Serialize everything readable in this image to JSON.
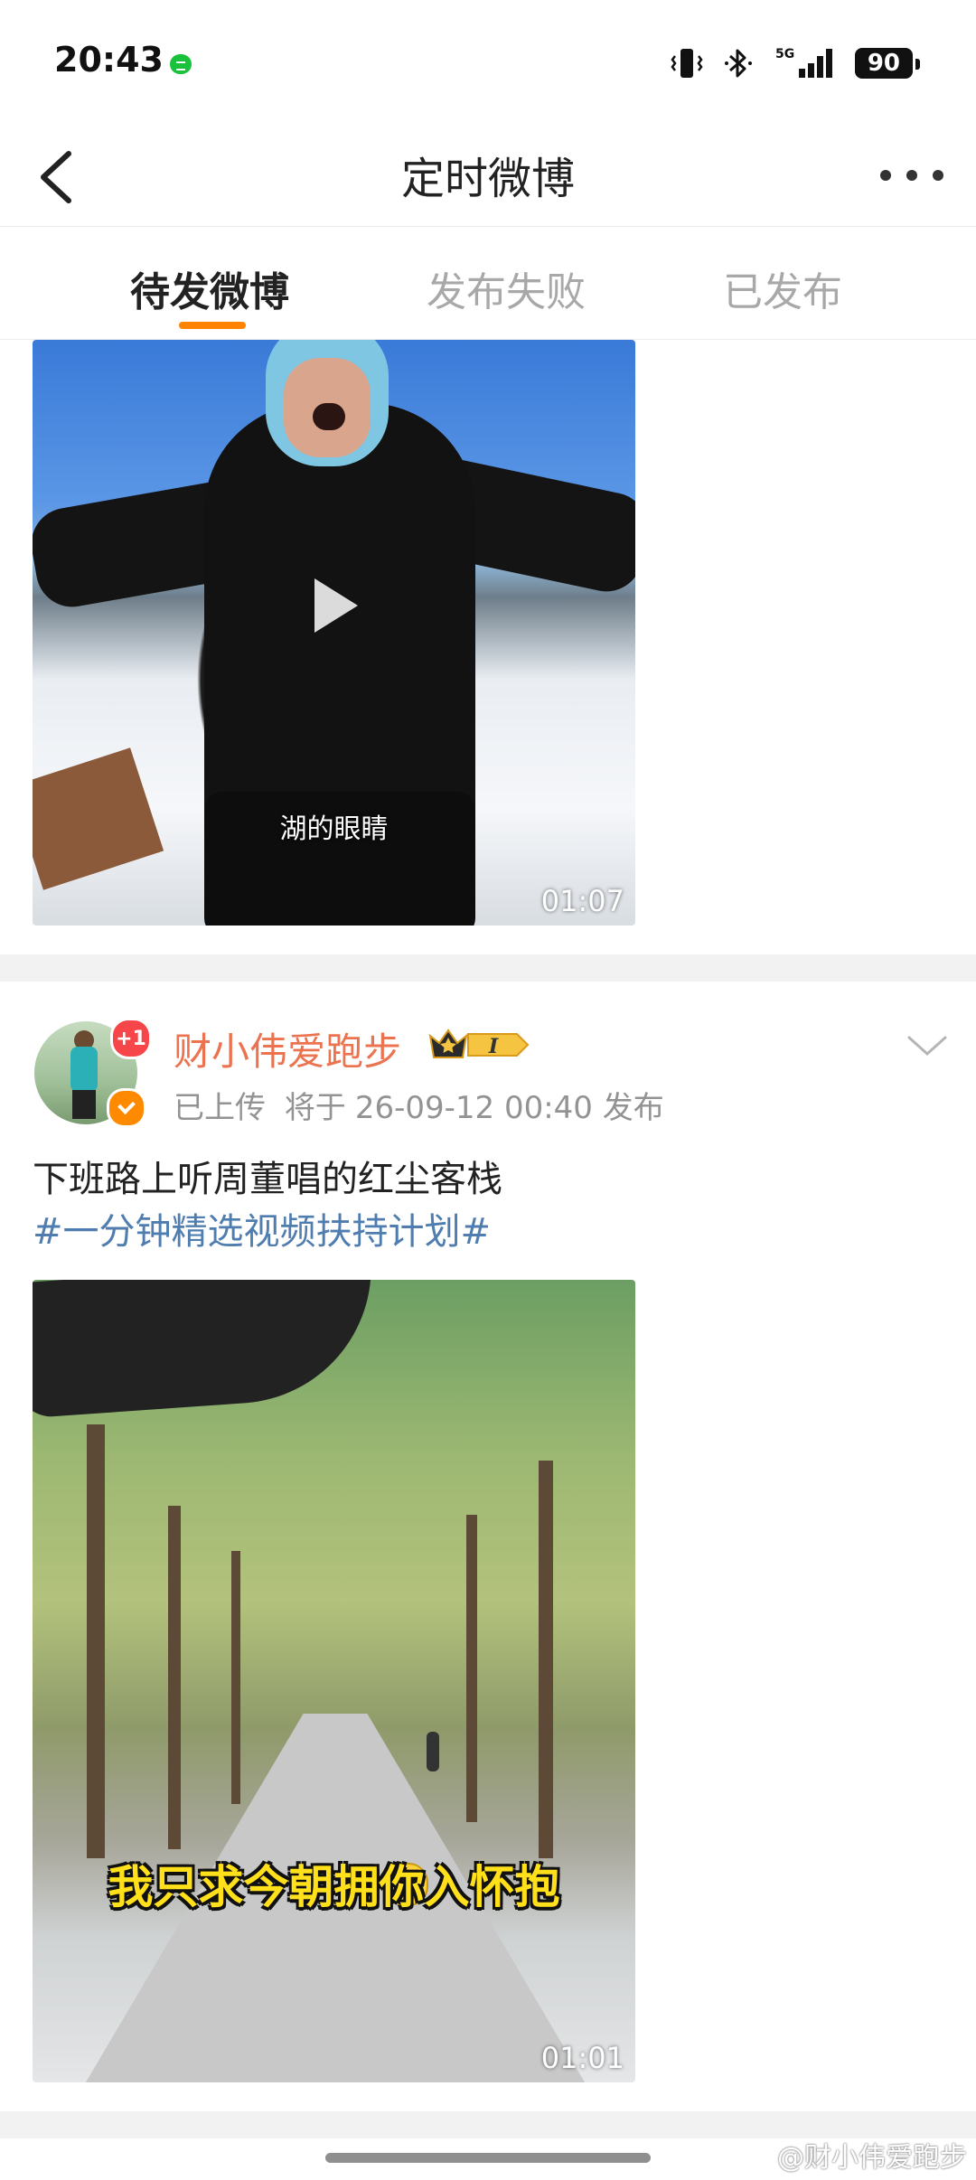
{
  "status_bar": {
    "time": "20:43",
    "network": "5G",
    "battery": "90"
  },
  "nav": {
    "title": "定时微博"
  },
  "tabs": [
    {
      "label": "待发微博",
      "active": true
    },
    {
      "label": "发布失败",
      "active": false
    },
    {
      "label": "已发布",
      "active": false
    }
  ],
  "post1": {
    "video_subtitle": "湖的眼睛",
    "duration": "01:07"
  },
  "post2": {
    "avatar_badge": "+1",
    "username": "财小伟爱跑步",
    "member_level": "I",
    "status": "已上传",
    "schedule_prefix": "将于",
    "schedule_time": "26-09-12 00:40",
    "schedule_suffix": "发布",
    "text": "下班路上听周董唱的红尘客栈",
    "hashtag": "#一分钟精选视频扶持计划#",
    "video_caption": "我只求今朝拥你入怀抱",
    "duration": "01:01"
  },
  "watermark": "@财小伟爱跑步",
  "colors": {
    "accent": "#ff8200",
    "username": "#eb7350",
    "hashtag": "#507daf",
    "meta": "#939393"
  }
}
